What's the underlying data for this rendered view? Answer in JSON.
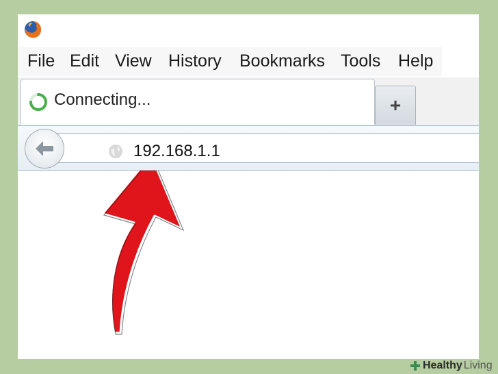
{
  "browser": {
    "menu": [
      "File",
      "Edit",
      "View",
      "History",
      "Bookmarks",
      "Tools",
      "Help"
    ],
    "tab": {
      "title": "Connecting..."
    },
    "new_tab_label": "+",
    "address": "192.168.1.1"
  },
  "icons": {
    "logo": "firefox-logo",
    "loading": "loading-spinner-icon",
    "back": "back-arrow-icon",
    "site": "globe-icon",
    "annotation": "red-arrow-pointing-to-address-bar"
  },
  "colors": {
    "background": "#b5cda0",
    "arrow": "#e0141b",
    "spinner": "#46b14a"
  },
  "watermark": {
    "part1": "Healthy",
    "part2": "Living"
  }
}
